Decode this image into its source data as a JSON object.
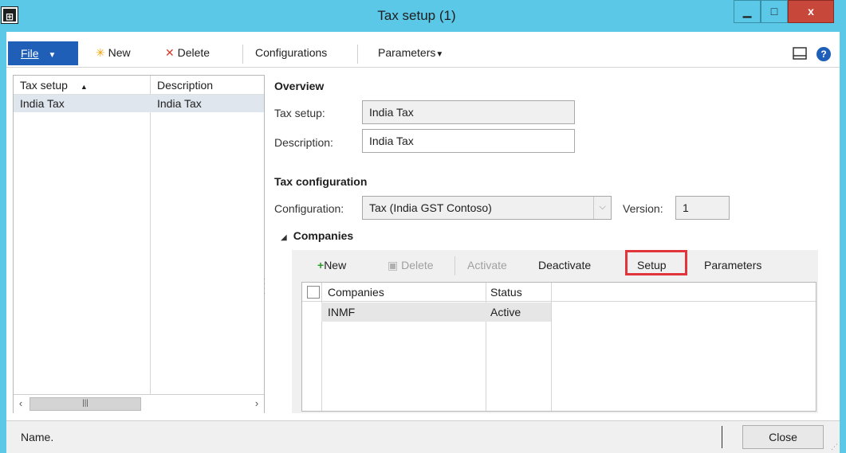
{
  "window": {
    "title": "Tax setup (1)",
    "app_icon": "ax-icon",
    "min": "▁",
    "max": "□",
    "close": "x"
  },
  "toolbar": {
    "file_label": "File",
    "new_label": "New",
    "delete_label": "Delete",
    "configurations_label": "Configurations",
    "parameters_label": "Parameters"
  },
  "list": {
    "col_tax_setup": "Tax setup",
    "col_description": "Description",
    "rows": [
      {
        "tax_setup": "India Tax",
        "description": "India Tax"
      }
    ]
  },
  "overview": {
    "heading": "Overview",
    "tax_setup_label": "Tax setup:",
    "tax_setup_value": "India Tax",
    "description_label": "Description:",
    "description_value": "India Tax"
  },
  "tax_configuration": {
    "heading": "Tax configuration",
    "configuration_label": "Configuration:",
    "configuration_value": "Tax (India GST Contoso)",
    "version_label": "Version:",
    "version_value": "1"
  },
  "companies": {
    "heading": "Companies",
    "toolbar": {
      "new": "New",
      "delete": "Delete",
      "activate": "Activate",
      "deactivate": "Deactivate",
      "setup": "Setup",
      "parameters": "Parameters"
    },
    "columns": {
      "companies": "Companies",
      "status": "Status"
    },
    "rows": [
      {
        "company": "INMF",
        "status": "Active"
      }
    ]
  },
  "status": {
    "text": "Name.",
    "close_label": "Close"
  },
  "colors": {
    "title_bar": "#5bc8e8",
    "file_button": "#1f5fb8",
    "highlight": "#e0353b",
    "close_button": "#c7473b"
  }
}
